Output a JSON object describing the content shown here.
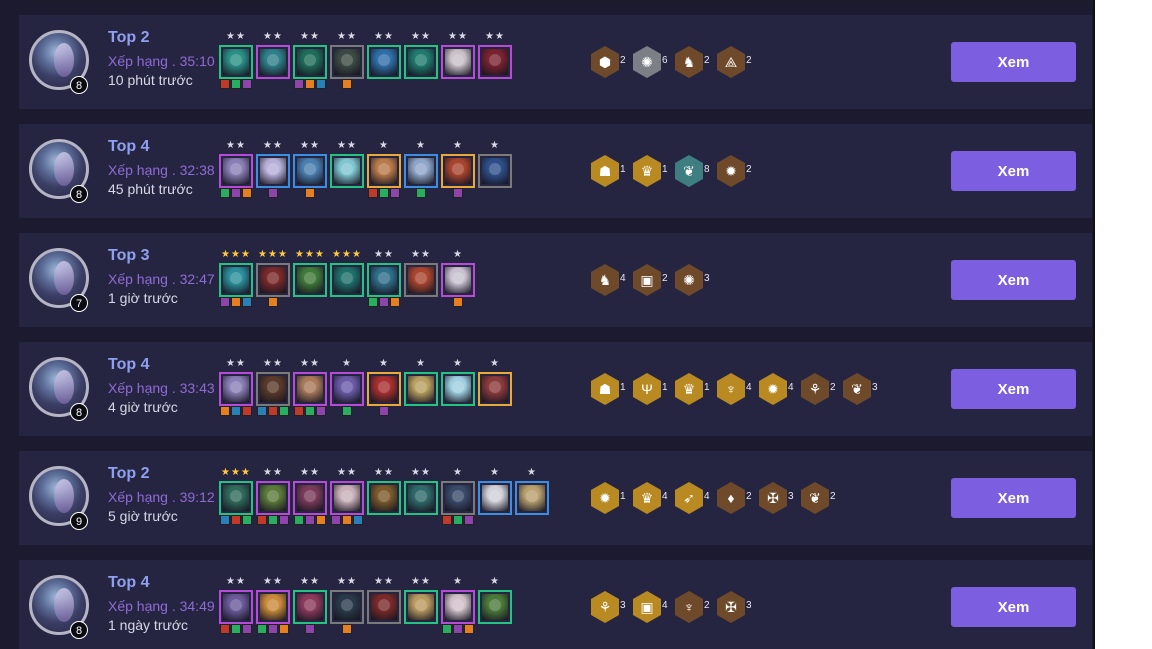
{
  "colors": {
    "app_bg": "#1b1a2e",
    "row_bg": "#262541",
    "placement": "#8fa0f0",
    "rank": "#8f6bd6",
    "time": "#d8d8e6",
    "button": "#7b5fe0",
    "star_gold": "#ffc83d",
    "star_silver": "#d9d9e6",
    "tier_bronze": "#6e4a2a",
    "tier_silver": "#7d7f87",
    "tier_gold": "#b98a22",
    "tier_teal": "#3e7e80"
  },
  "matches": [
    {
      "placement": "Top 2",
      "rank": "Xếp hạng . 35:10",
      "time_ago": "10 phút trước",
      "level": "8",
      "button": "Xem",
      "units": [
        {
          "stars": "★★",
          "star_color": "silver",
          "border": "#26c281",
          "tone": "#2a8f86",
          "items": 3
        },
        {
          "stars": "★★",
          "star_color": "silver",
          "border": "#b64bd8",
          "tone": "#2f7f8a",
          "items": 0
        },
        {
          "stars": "★★",
          "star_color": "silver",
          "border": "#26c281",
          "tone": "#1f6d5a",
          "items": 3
        },
        {
          "stars": "★★",
          "star_color": "silver",
          "border": "#7a7a7a",
          "tone": "#3c4a44",
          "items": 1
        },
        {
          "stars": "★★",
          "star_color": "silver",
          "border": "#26c281",
          "tone": "#2f6fa8",
          "items": 0
        },
        {
          "stars": "★★",
          "star_color": "silver",
          "border": "#26c281",
          "tone": "#1f7a6f",
          "items": 0
        },
        {
          "stars": "★★",
          "star_color": "silver",
          "border": "#b64bd8",
          "tone": "#c9c0c8",
          "items": 0
        },
        {
          "stars": "★★",
          "star_color": "silver",
          "border": "#b64bd8",
          "tone": "#7a2230",
          "items": 0
        }
      ],
      "traits": [
        {
          "icon": "cube-trait-icon",
          "glyph": "⬢",
          "count": "2",
          "tier": "bronze"
        },
        {
          "icon": "flame-trait-icon",
          "glyph": "✺",
          "count": "6",
          "tier": "silver"
        },
        {
          "icon": "horse-trait-icon",
          "glyph": "♞",
          "count": "2",
          "tier": "bronze"
        },
        {
          "icon": "bird-trait-icon",
          "glyph": "⟁",
          "count": "2",
          "tier": "bronze"
        }
      ]
    },
    {
      "placement": "Top 4",
      "rank": "Xếp hạng . 32:38",
      "time_ago": "45 phút trước",
      "level": "8",
      "button": "Xem",
      "units": [
        {
          "stars": "★★",
          "star_color": "silver",
          "border": "#b64bd8",
          "tone": "#8a7fb5",
          "items": 3
        },
        {
          "stars": "★★",
          "star_color": "silver",
          "border": "#3d8ee0",
          "tone": "#b6b0d9",
          "items": 1
        },
        {
          "stars": "★★",
          "star_color": "silver",
          "border": "#3d8ee0",
          "tone": "#4b7fb0",
          "items": 1
        },
        {
          "stars": "★★",
          "star_color": "silver",
          "border": "#26c281",
          "tone": "#7fc6d0",
          "items": 0
        },
        {
          "stars": "★",
          "star_color": "silver",
          "border": "#e8a93b",
          "tone": "#b87a4a",
          "items": 3
        },
        {
          "stars": "★",
          "star_color": "silver",
          "border": "#3d8ee0",
          "tone": "#8fa6c9",
          "items": 1
        },
        {
          "stars": "★",
          "star_color": "silver",
          "border": "#e8a93b",
          "tone": "#a8452f",
          "items": 1
        },
        {
          "stars": "★",
          "star_color": "silver",
          "border": "#7a7a7a",
          "tone": "#2f4f8a",
          "items": 0
        }
      ],
      "traits": [
        {
          "icon": "mask-trait-icon",
          "glyph": "☗",
          "count": "1",
          "tier": "gold"
        },
        {
          "icon": "crown-trait-icon",
          "glyph": "♛",
          "count": "1",
          "tier": "gold"
        },
        {
          "icon": "wings-trait-icon",
          "glyph": "❦",
          "count": "8",
          "tier": "teal"
        },
        {
          "icon": "spiral-trait-icon",
          "glyph": "✹",
          "count": "2",
          "tier": "bronze"
        }
      ]
    },
    {
      "placement": "Top 3",
      "rank": "Xếp hạng . 32:47",
      "time_ago": "1 giờ trước",
      "level": "7",
      "button": "Xem",
      "units": [
        {
          "stars": "★★★",
          "star_color": "gold",
          "border": "#26c281",
          "tone": "#2a8f9a",
          "items": 3
        },
        {
          "stars": "★★★",
          "star_color": "gold",
          "border": "#7a7a7a",
          "tone": "#7a2a2a",
          "items": 1
        },
        {
          "stars": "★★★",
          "star_color": "gold",
          "border": "#26c281",
          "tone": "#3f7a3a",
          "items": 0
        },
        {
          "stars": "★★★",
          "star_color": "gold",
          "border": "#26c281",
          "tone": "#1f6f6a",
          "items": 0
        },
        {
          "stars": "★★",
          "star_color": "silver",
          "border": "#26c281",
          "tone": "#2f6f8a",
          "items": 3
        },
        {
          "stars": "★★",
          "star_color": "silver",
          "border": "#7a7a7a",
          "tone": "#a8452f",
          "items": 0
        },
        {
          "stars": "★",
          "star_color": "silver",
          "border": "#b64bd8",
          "tone": "#c9c0d0",
          "items": 1
        }
      ],
      "traits": [
        {
          "icon": "horse-trait-icon",
          "glyph": "♞",
          "count": "4",
          "tier": "bronze"
        },
        {
          "icon": "book-trait-icon",
          "glyph": "▣",
          "count": "2",
          "tier": "bronze"
        },
        {
          "icon": "flame-trait-icon",
          "glyph": "✺",
          "count": "3",
          "tier": "bronze"
        }
      ]
    },
    {
      "placement": "Top 4",
      "rank": "Xếp hạng . 33:43",
      "time_ago": "4 giờ trước",
      "level": "8",
      "button": "Xem",
      "units": [
        {
          "stars": "★★",
          "star_color": "silver",
          "border": "#b64bd8",
          "tone": "#8a7fb5",
          "items": 3
        },
        {
          "stars": "★★",
          "star_color": "silver",
          "border": "#7a7a7a",
          "tone": "#5a3a2a",
          "items": 3
        },
        {
          "stars": "★★",
          "star_color": "silver",
          "border": "#b64bd8",
          "tone": "#a87a5a",
          "items": 3
        },
        {
          "stars": "★",
          "star_color": "silver",
          "border": "#b64bd8",
          "tone": "#6a5aa8",
          "items": 1
        },
        {
          "stars": "★",
          "star_color": "silver",
          "border": "#e8a93b",
          "tone": "#a82f2f",
          "items": 1
        },
        {
          "stars": "★",
          "star_color": "silver",
          "border": "#26c281",
          "tone": "#b8a060",
          "items": 0
        },
        {
          "stars": "★",
          "star_color": "silver",
          "border": "#26c281",
          "tone": "#9fcfe0",
          "items": 0
        },
        {
          "stars": "★",
          "star_color": "silver",
          "border": "#e8a93b",
          "tone": "#8a3a3a",
          "items": 0
        }
      ],
      "traits": [
        {
          "icon": "mask-trait-icon",
          "glyph": "☗",
          "count": "1",
          "tier": "gold"
        },
        {
          "icon": "trident-trait-icon",
          "glyph": "Ψ",
          "count": "1",
          "tier": "gold"
        },
        {
          "icon": "crown-trait-icon",
          "glyph": "♛",
          "count": "1",
          "tier": "gold"
        },
        {
          "icon": "chalice-trait-icon",
          "glyph": "♆",
          "count": "4",
          "tier": "gold"
        },
        {
          "icon": "spiral-trait-icon",
          "glyph": "✹",
          "count": "4",
          "tier": "gold"
        },
        {
          "icon": "claw-trait-icon",
          "glyph": "⚘",
          "count": "2",
          "tier": "bronze"
        },
        {
          "icon": "wings-trait-icon",
          "glyph": "❦",
          "count": "3",
          "tier": "bronze"
        }
      ]
    },
    {
      "placement": "Top 2",
      "rank": "Xếp hạng . 39:12",
      "time_ago": "5 giờ trước",
      "level": "9",
      "button": "Xem",
      "units": [
        {
          "stars": "★★★",
          "star_color": "gold",
          "border": "#26c281",
          "tone": "#2f6a5a",
          "items": 3
        },
        {
          "stars": "★★",
          "star_color": "silver",
          "border": "#b64bd8",
          "tone": "#5a7a3a",
          "items": 3
        },
        {
          "stars": "★★",
          "star_color": "silver",
          "border": "#b64bd8",
          "tone": "#7a3a5a",
          "items": 3
        },
        {
          "stars": "★★",
          "star_color": "silver",
          "border": "#b64bd8",
          "tone": "#c9b0b8",
          "items": 3
        },
        {
          "stars": "★★",
          "star_color": "silver",
          "border": "#26c281",
          "tone": "#7a5a2a",
          "items": 0
        },
        {
          "stars": "★★",
          "star_color": "silver",
          "border": "#26c281",
          "tone": "#2f6a6a",
          "items": 0
        },
        {
          "stars": "★",
          "star_color": "silver",
          "border": "#7a7a7a",
          "tone": "#3a4a6a",
          "items": 3
        },
        {
          "stars": "★",
          "star_color": "silver",
          "border": "#3d8ee0",
          "tone": "#d0d0d8",
          "items": 0
        },
        {
          "stars": "★",
          "star_color": "silver",
          "border": "#3d8ee0",
          "tone": "#b8a070",
          "items": 0
        }
      ],
      "traits": [
        {
          "icon": "spiral-trait-icon",
          "glyph": "✹",
          "count": "1",
          "tier": "gold"
        },
        {
          "icon": "crown-trait-icon",
          "glyph": "♛",
          "count": "4",
          "tier": "gold"
        },
        {
          "icon": "dragon-trait-icon",
          "glyph": "➶",
          "count": "4",
          "tier": "gold"
        },
        {
          "icon": "drop-trait-icon",
          "glyph": "♦",
          "count": "2",
          "tier": "bronze"
        },
        {
          "icon": "angel-trait-icon",
          "glyph": "✠",
          "count": "3",
          "tier": "bronze"
        },
        {
          "icon": "wings-trait-icon",
          "glyph": "❦",
          "count": "2",
          "tier": "bronze"
        }
      ]
    },
    {
      "placement": "Top 4",
      "rank": "Xếp hạng . 34:49",
      "time_ago": "1 ngày trước",
      "level": "8",
      "button": "Xem",
      "units": [
        {
          "stars": "★★",
          "star_color": "silver",
          "border": "#b64bd8",
          "tone": "#6a5a9a",
          "items": 3
        },
        {
          "stars": "★★",
          "star_color": "silver",
          "border": "#b64bd8",
          "tone": "#c98a3a",
          "items": 3
        },
        {
          "stars": "★★",
          "star_color": "silver",
          "border": "#26c281",
          "tone": "#8a3a5a",
          "items": 1
        },
        {
          "stars": "★★",
          "star_color": "silver",
          "border": "#7a7a7a",
          "tone": "#2a3a4a",
          "items": 1
        },
        {
          "stars": "★★",
          "star_color": "silver",
          "border": "#7a7a7a",
          "tone": "#7a2a2a",
          "items": 0
        },
        {
          "stars": "★★",
          "star_color": "silver",
          "border": "#26c281",
          "tone": "#b89a60",
          "items": 0
        },
        {
          "stars": "★",
          "star_color": "silver",
          "border": "#b64bd8",
          "tone": "#d0c0c8",
          "items": 3
        },
        {
          "stars": "★",
          "star_color": "silver",
          "border": "#26c281",
          "tone": "#4a7a3a",
          "items": 0
        }
      ],
      "traits": [
        {
          "icon": "claw-trait-icon",
          "glyph": "⚘",
          "count": "3",
          "tier": "gold"
        },
        {
          "icon": "book-trait-icon",
          "glyph": "▣",
          "count": "4",
          "tier": "gold"
        },
        {
          "icon": "chalice-trait-icon",
          "glyph": "♆",
          "count": "2",
          "tier": "bronze"
        },
        {
          "icon": "angel-trait-icon",
          "glyph": "✠",
          "count": "3",
          "tier": "bronze"
        }
      ]
    }
  ]
}
